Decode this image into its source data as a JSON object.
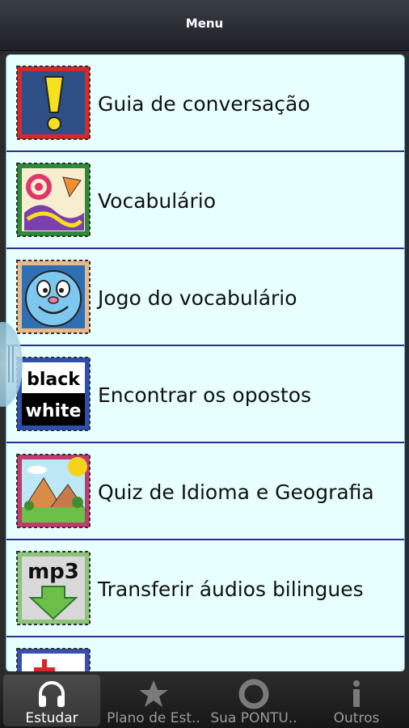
{
  "header": {
    "title": "Menu"
  },
  "menu": {
    "items": [
      {
        "label": "Guia de conversação",
        "icon": "exclamation-stamp-icon"
      },
      {
        "label": "Vocabulário",
        "icon": "shapes-stamp-icon"
      },
      {
        "label": "Jogo do vocabulário",
        "icon": "smiley-stamp-icon"
      },
      {
        "label": "Encontrar os opostos",
        "icon": "black-white-stamp-icon",
        "icon_text": [
          "black",
          "white"
        ]
      },
      {
        "label": "Quiz de Idioma e Geografia",
        "icon": "landscape-stamp-icon"
      },
      {
        "label": "Transferir áudios bilingues",
        "icon": "mp3-download-stamp-icon",
        "icon_text": "mp3"
      }
    ]
  },
  "tabs": [
    {
      "label": "Estudar",
      "icon": "headphones-icon",
      "active": true
    },
    {
      "label": "Plano de Est..",
      "icon": "star-icon",
      "active": false
    },
    {
      "label": "Sua PONTU..",
      "icon": "circle-icon",
      "active": false
    },
    {
      "label": "Outros",
      "icon": "info-icon",
      "active": false
    }
  ],
  "colors": {
    "list_bg": "#e8ffff",
    "divider": "#2c2c8a",
    "header_bg": "#2a2e35"
  }
}
